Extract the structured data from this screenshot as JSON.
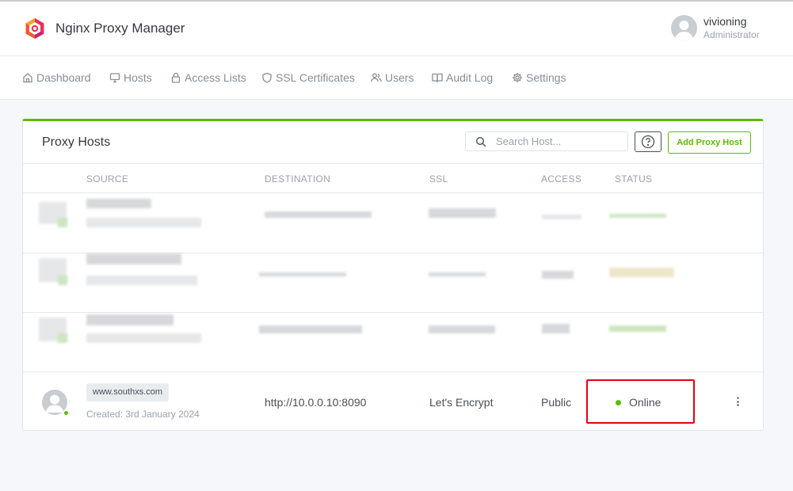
{
  "header": {
    "app_name": "Nginx Proxy Manager",
    "user_name": "vivioning",
    "user_role": "Administrator"
  },
  "nav": {
    "items": [
      {
        "label": "Dashboard",
        "icon": "home-icon"
      },
      {
        "label": "Hosts",
        "icon": "monitor-icon"
      },
      {
        "label": "Access Lists",
        "icon": "lock-icon"
      },
      {
        "label": "SSL Certificates",
        "icon": "shield-icon"
      },
      {
        "label": "Users",
        "icon": "users-icon"
      },
      {
        "label": "Audit Log",
        "icon": "book-icon"
      },
      {
        "label": "Settings",
        "icon": "gear-icon"
      }
    ]
  },
  "card": {
    "title": "Proxy Hosts",
    "search_placeholder": "Search Host...",
    "add_button": "Add Proxy Host",
    "columns": [
      "SOURCE",
      "DESTINATION",
      "SSL",
      "ACCESS",
      "STATUS"
    ]
  },
  "visible_row": {
    "domain": "www.southxs.com",
    "created": "Created: 3rd January 2024",
    "destination": "http://10.0.0.10:8090",
    "ssl": "Let's Encrypt",
    "access": "Public",
    "status": "Online"
  },
  "colors": {
    "accent": "#5eba00",
    "highlight": "#e60012"
  }
}
